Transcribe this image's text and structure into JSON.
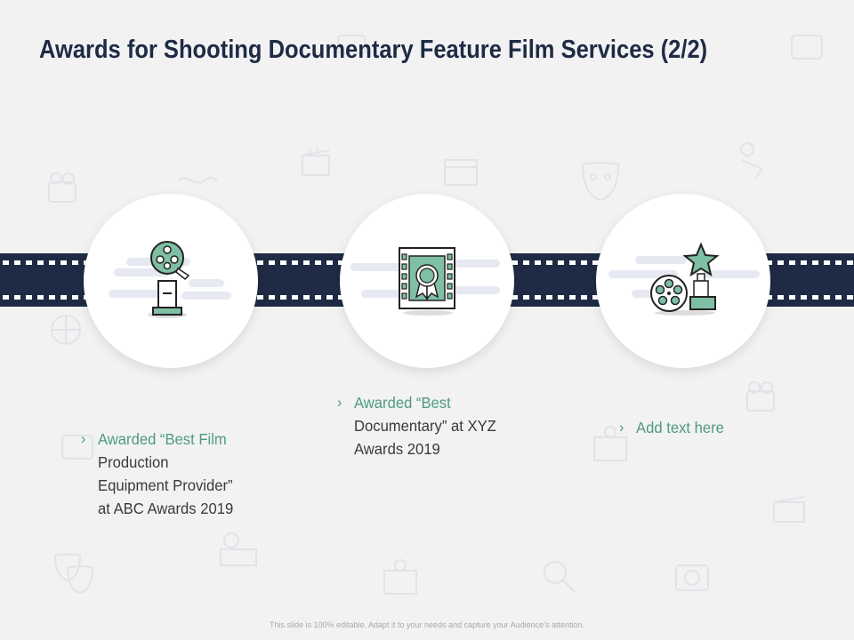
{
  "slide": {
    "title": "Awards for Shooting Documentary Feature Film Services (2/2)",
    "footer": "This slide is 100% editable. Adapt it to your needs and capture your Audience’s attention."
  },
  "awards": [
    {
      "icon": "film-reel-trophy-icon",
      "lines": [
        "Awarded “Best Film",
        "Production",
        "Equipment Provider”",
        "at ABC Awards 2019"
      ]
    },
    {
      "icon": "film-frame-medal-icon",
      "lines": [
        "Awarded “Best",
        "Documentary” at XYZ",
        "Awards 2019"
      ]
    },
    {
      "icon": "star-trophy-reel-icon",
      "lines": [
        "Add text here"
      ]
    }
  ],
  "colors": {
    "background": "#f2f2f3",
    "title": "#1f2b45",
    "film_strip": "#1f2b45",
    "accent_green": "#4e9a7e",
    "icon_green": "#7fbfa4",
    "body_text": "#3a3a3a",
    "footer_text": "#a8a8ae"
  }
}
